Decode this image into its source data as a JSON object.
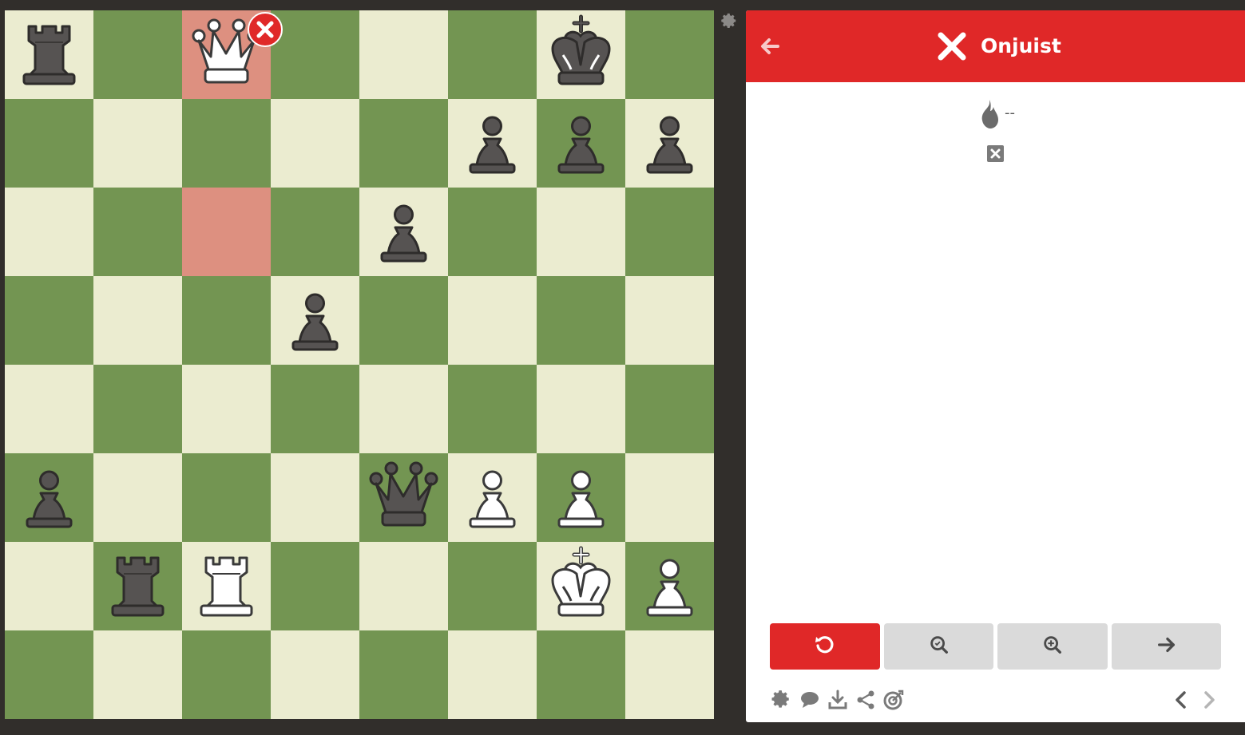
{
  "board": {
    "light_color": "#ebecd0",
    "dark_color": "#739552",
    "highlight_color": "#dd9080",
    "highlighted_squares": [
      "c8",
      "c6"
    ],
    "pieces": [
      {
        "square": "a8",
        "piece": "rook",
        "color": "black"
      },
      {
        "square": "c8",
        "piece": "queen",
        "color": "white"
      },
      {
        "square": "g8",
        "piece": "king",
        "color": "black"
      },
      {
        "square": "f7",
        "piece": "pawn",
        "color": "black"
      },
      {
        "square": "g7",
        "piece": "pawn",
        "color": "black"
      },
      {
        "square": "h7",
        "piece": "pawn",
        "color": "black"
      },
      {
        "square": "e6",
        "piece": "pawn",
        "color": "black"
      },
      {
        "square": "d5",
        "piece": "pawn",
        "color": "black"
      },
      {
        "square": "a3",
        "piece": "pawn",
        "color": "black"
      },
      {
        "square": "e3",
        "piece": "queen",
        "color": "black"
      },
      {
        "square": "f3",
        "piece": "pawn",
        "color": "white"
      },
      {
        "square": "g3",
        "piece": "pawn",
        "color": "white"
      },
      {
        "square": "b2",
        "piece": "rook",
        "color": "black"
      },
      {
        "square": "c2",
        "piece": "rook",
        "color": "white"
      },
      {
        "square": "g2",
        "piece": "king",
        "color": "white"
      },
      {
        "square": "h2",
        "piece": "pawn",
        "color": "white"
      }
    ],
    "wrong_move_marker_square": "c8"
  },
  "panel": {
    "header": {
      "title": "Onjuist",
      "color": "#e02828",
      "back_icon": "arrow-left-icon",
      "status_icon": "x-mark-icon"
    },
    "streak": {
      "icon": "flame-icon",
      "value": "--"
    },
    "result_icon": "x-box-icon",
    "buttons": [
      {
        "name": "retry-button",
        "icon": "retry-icon",
        "style": "red"
      },
      {
        "name": "hint-button",
        "icon": "magnifier-icon",
        "style": "grey"
      },
      {
        "name": "analyze-button",
        "icon": "magnifier-plus-icon",
        "style": "grey"
      },
      {
        "name": "next-button",
        "icon": "arrow-right-icon",
        "style": "grey"
      }
    ],
    "footer_icons": [
      "gear-icon",
      "chat-icon",
      "download-icon",
      "share-icon",
      "target-icon",
      "chevron-left-icon",
      "chevron-right-icon"
    ]
  }
}
